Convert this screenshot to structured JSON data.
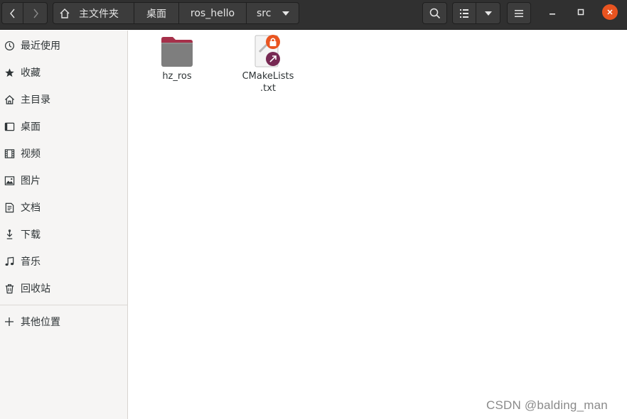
{
  "header": {
    "breadcrumbs": [
      "主文件夹",
      "桌面",
      "ros_hello",
      "src"
    ]
  },
  "sidebar": {
    "items": [
      {
        "label": "最近使用",
        "icon": "clock-icon"
      },
      {
        "label": "收藏",
        "icon": "star-icon"
      },
      {
        "label": "主目录",
        "icon": "home-icon"
      },
      {
        "label": "桌面",
        "icon": "desktop-icon"
      },
      {
        "label": "视频",
        "icon": "film-icon"
      },
      {
        "label": "图片",
        "icon": "image-icon"
      },
      {
        "label": "文档",
        "icon": "document-icon"
      },
      {
        "label": "下载",
        "icon": "download-icon"
      },
      {
        "label": "音乐",
        "icon": "music-icon"
      },
      {
        "label": "回收站",
        "icon": "trash-icon"
      }
    ],
    "other_locations": {
      "label": "其他位置",
      "icon": "plus-icon"
    }
  },
  "files": [
    {
      "name": "hz_ros",
      "type": "folder"
    },
    {
      "name_line1": "CMakeLists",
      "name_line2": ".txt",
      "type": "symlink-text-locked"
    }
  ],
  "watermark": "CSDN @balding_man",
  "colors": {
    "headerbar": "#303030",
    "accent": "#e95420",
    "folder": "#7e7e7e",
    "folder_tab": "#a6304a",
    "symlink_badge": "#772953"
  }
}
